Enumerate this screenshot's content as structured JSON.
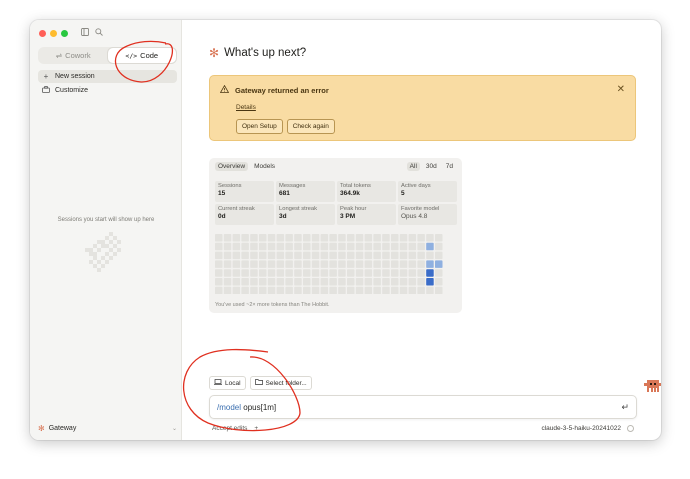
{
  "sidebar": {
    "modes": [
      {
        "label": "Cowork",
        "icon": "cowork-icon"
      },
      {
        "label": "Code",
        "icon": "code-icon"
      }
    ],
    "nav": [
      {
        "label": "New session",
        "icon": "plus-icon"
      },
      {
        "label": "Customize",
        "icon": "briefcase-icon"
      }
    ],
    "empty_text": "Sessions you start will show up here",
    "footer_label": "Gateway"
  },
  "main": {
    "heading": "What's up next?",
    "error": {
      "title": "Gateway returned an error",
      "details_label": "Details",
      "open_setup_label": "Open Setup",
      "check_again_label": "Check again"
    },
    "stats": {
      "tabs": [
        "Overview",
        "Models"
      ],
      "ranges": [
        "All",
        "30d",
        "7d"
      ],
      "cells": [
        {
          "label": "Sessions",
          "value": "15"
        },
        {
          "label": "Messages",
          "value": "681"
        },
        {
          "label": "Total tokens",
          "value": "364.9k"
        },
        {
          "label": "Active days",
          "value": "5"
        },
        {
          "label": "Current streak",
          "value": "0d"
        },
        {
          "label": "Longest streak",
          "value": "3d"
        },
        {
          "label": "Peak hour",
          "value": "3 PM"
        },
        {
          "label": "Favorite model",
          "value": "Opus 4.8"
        }
      ],
      "footnote": "You've used ~2× more tokens than The Hobbit."
    },
    "composer": {
      "local_label": "Local",
      "folder_label": "Select folder...",
      "command_slash": "/model",
      "command_arg": "opus[1m]",
      "accept_label": "Accept edits",
      "add_label": "+",
      "model_name": "claude-3-5-haiku-20241022"
    }
  },
  "colors": {
    "accent": "#d97757",
    "error_bg": "#f9dca3",
    "heat_light": "#8fb0e0",
    "heat_dark": "#3a6cc8",
    "annotation": "#e03020"
  }
}
